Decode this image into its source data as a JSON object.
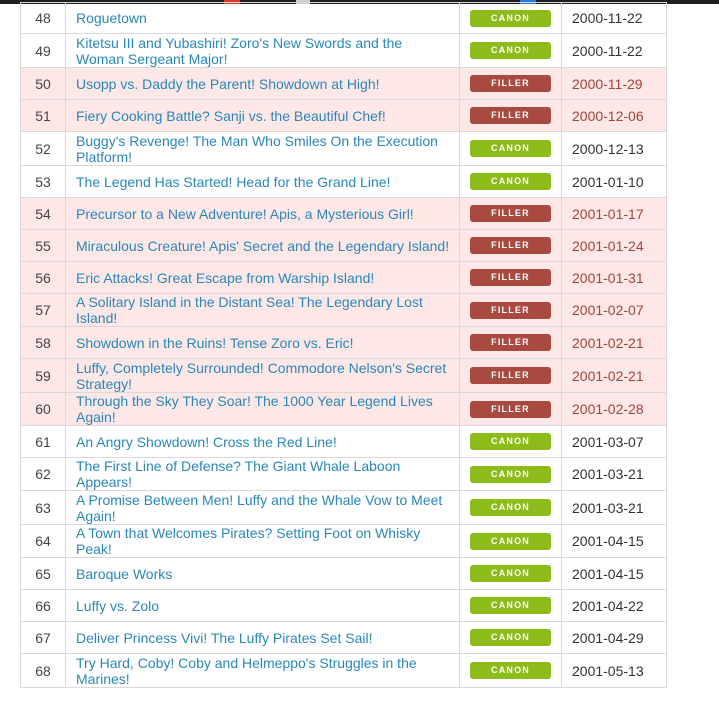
{
  "colors": {
    "canon_badge": "#8cbb1a",
    "filler_badge": "#a94a40",
    "filler_row_bg": "#fde7e7",
    "link": "#2a87b8",
    "filler_date": "#a5443a"
  },
  "labels": {
    "canon": "CANON",
    "filler": "FILLER"
  },
  "episodes": [
    {
      "number": "48",
      "title": "Roguetown",
      "type": "canon",
      "date": "2000-11-22"
    },
    {
      "number": "49",
      "title": "Kitetsu III and Yubashiri! Zoro's New Swords and the Woman Sergeant Major!",
      "type": "canon",
      "date": "2000-11-22"
    },
    {
      "number": "50",
      "title": "Usopp vs. Daddy the Parent! Showdown at High!",
      "type": "filler",
      "date": "2000-11-29"
    },
    {
      "number": "51",
      "title": "Fiery Cooking Battle? Sanji vs. the Beautiful Chef!",
      "type": "filler",
      "date": "2000-12-06"
    },
    {
      "number": "52",
      "title": "Buggy's Revenge! The Man Who Smiles On the Execution Platform!",
      "type": "canon",
      "date": "2000-12-13"
    },
    {
      "number": "53",
      "title": "The Legend Has Started! Head for the Grand Line!",
      "type": "canon",
      "date": "2001-01-10"
    },
    {
      "number": "54",
      "title": "Precursor to a New Adventure! Apis, a Mysterious Girl!",
      "type": "filler",
      "date": "2001-01-17"
    },
    {
      "number": "55",
      "title": "Miraculous Creature! Apis' Secret and the Legendary Island!",
      "type": "filler",
      "date": "2001-01-24"
    },
    {
      "number": "56",
      "title": "Eric Attacks! Great Escape from Warship Island!",
      "type": "filler",
      "date": "2001-01-31"
    },
    {
      "number": "57",
      "title": "A Solitary Island in the Distant Sea! The Legendary Lost Island!",
      "type": "filler",
      "date": "2001-02-07"
    },
    {
      "number": "58",
      "title": "Showdown in the Ruins! Tense Zoro vs. Eric!",
      "type": "filler",
      "date": "2001-02-21"
    },
    {
      "number": "59",
      "title": "Luffy, Completely Surrounded! Commodore Nelson's Secret Strategy!",
      "type": "filler",
      "date": "2001-02-21"
    },
    {
      "number": "60",
      "title": "Through the Sky They Soar! The 1000 Year Legend Lives Again!",
      "type": "filler",
      "date": "2001-02-28"
    },
    {
      "number": "61",
      "title": "An Angry Showdown! Cross the Red Line!",
      "type": "canon",
      "date": "2001-03-07"
    },
    {
      "number": "62",
      "title": "The First Line of Defense? The Giant Whale Laboon Appears!",
      "type": "canon",
      "date": "2001-03-21"
    },
    {
      "number": "63",
      "title": "A Promise Between Men! Luffy and the Whale Vow to Meet Again!",
      "type": "canon",
      "date": "2001-03-21"
    },
    {
      "number": "64",
      "title": "A Town that Welcomes Pirates? Setting Foot on Whisky Peak!",
      "type": "canon",
      "date": "2001-04-15"
    },
    {
      "number": "65",
      "title": "Baroque Works",
      "type": "canon",
      "date": "2001-04-15"
    },
    {
      "number": "66",
      "title": "Luffy vs. Zolo",
      "type": "canon",
      "date": "2001-04-22"
    },
    {
      "number": "67",
      "title": "Deliver Princess Vivi! The Luffy Pirates Set Sail!",
      "type": "canon",
      "date": "2001-04-29"
    },
    {
      "number": "68",
      "title": "Try Hard, Coby! Coby and Helmeppo's Struggles in the Marines!",
      "type": "canon",
      "date": "2001-05-13"
    }
  ]
}
